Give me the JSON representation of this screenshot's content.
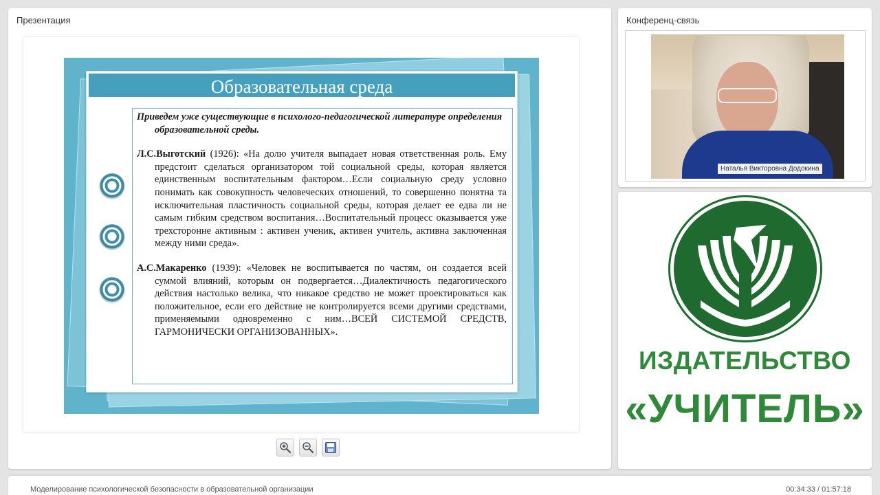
{
  "presentation": {
    "panel_title": "Презентация",
    "slide": {
      "title": "Образовательная среда",
      "intro": "Приведем уже существующие в психолого-педагогической литературе определения образовательной среды.",
      "quotes": [
        {
          "author": "Л.С.Выготский",
          "text": " (1926): «На долю учителя выпадает новая ответственная роль. Ему предстоит сделаться организатором той социальной среды, которая является единственным воспитательным фактором…Если социальную среду условно понимать как совокупность человеческих отношений, то совершенно понятна та исключительная пластичность социальной среды, которая делает ее едва ли не самым гибким средством воспитания…Воспитательный процесс оказывается уже трехсторонне активным : активен ученик, активен учитель, активна заключенная между ними среда»."
        },
        {
          "author": "А.С.Макаренко",
          "text": " (1939): «Человек не воспитывается по частям, он создается всей суммой влияний, которым он подвергается…Диалектичность педагогического действия настолько велика, что никакое средство не может проектироваться как положительное, если его действие не контролируется всеми другими средствами, применяемыми одновременно с ним…ВСЕЙ СИСТЕМОЙ СРЕДСТВ, ГАРМОНИЧЕСКИ ОРГАНИЗОВАННЫХ»."
        }
      ],
      "bullets_icon": "ring-bullet-icon"
    },
    "toolbar": {
      "zoom_in_icon": "zoom-in-icon",
      "zoom_out_icon": "zoom-out-icon",
      "save_icon": "save-icon"
    }
  },
  "conference": {
    "panel_title": "Конференц-связь",
    "speaker_name": "Наталья Викторовна Додокина"
  },
  "logo": {
    "line1": "ИЗДАТЕЛЬСТВО",
    "line2": "«УЧИТЕЛЬ»",
    "brand_color": "#2e8a38",
    "dark_green": "#1f6a2e"
  },
  "bottom_bar": {
    "webinar_title": "Моделирование психологической безопасности в образовательной организации",
    "timecode": "00:34:33 / 01:57:18"
  },
  "colors": {
    "slide_teal": "#5fb4cc",
    "title_bar": "#45a0bd",
    "background": "#e4e4e4"
  }
}
